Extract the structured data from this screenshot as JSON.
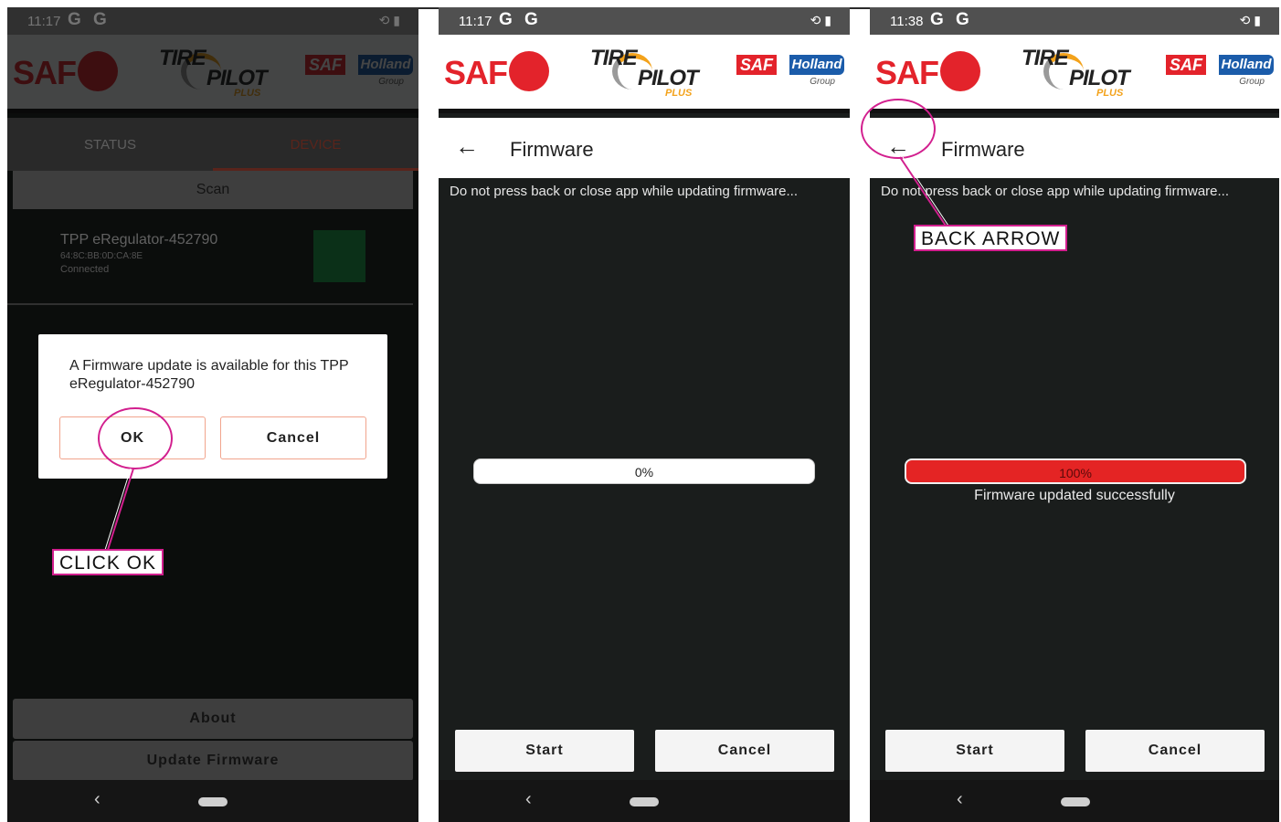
{
  "screens": [
    {
      "status": {
        "time": "11:17",
        "g_icons": "G G"
      },
      "logos": {
        "saf": "SAF",
        "tire1": "TIRE",
        "tire2": "PILOT",
        "tire3": "PLUS",
        "holland1": "SAF",
        "holland2": "Holland",
        "holland3": "Group"
      },
      "tabs": {
        "left": "STATUS",
        "right": "DEVICE"
      },
      "scan": "Scan",
      "device": {
        "name": "TPP eRegulator-452790",
        "mac": "64:8C:BB:0D:CA:8E",
        "state": "Connected",
        "color": "#1a6b35"
      },
      "dialog": {
        "message": "A Firmware update is available for this TPP eRegulator-452790",
        "ok": "OK",
        "cancel": "Cancel"
      },
      "buttons": {
        "about": "About",
        "update": "Update Firmware"
      }
    },
    {
      "status": {
        "time": "11:17",
        "g_icons": "G G"
      },
      "logos": {
        "saf": "SAF",
        "tire1": "TIRE",
        "tire2": "PILOT",
        "tire3": "PLUS",
        "holland1": "SAF",
        "holland2": "Holland",
        "holland3": "Group"
      },
      "title": "Firmware",
      "warning": "Do not press back or close app while updating firmware...",
      "progress": {
        "label": "0%",
        "value": 0
      },
      "buttons": {
        "start": "Start",
        "cancel": "Cancel"
      }
    },
    {
      "status": {
        "time": "11:38",
        "g_icons": "G G"
      },
      "logos": {
        "saf": "SAF",
        "tire1": "TIRE",
        "tire2": "PILOT",
        "tire3": "PLUS",
        "holland1": "SAF",
        "holland2": "Holland",
        "holland3": "Group"
      },
      "title": "Firmware",
      "warning": "Do not press back or close app while updating firmware...",
      "progress": {
        "label": "100%",
        "value": 100,
        "color": "#e42424"
      },
      "success": "Firmware updated successfully",
      "buttons": {
        "start": "Start",
        "cancel": "Cancel"
      }
    }
  ],
  "annotations": {
    "click_ok": "CLICK OK",
    "back_arrow": "BACK ARROW",
    "color": "#d21f8e"
  },
  "icons": {
    "back_arrow": "arrow-left-icon",
    "nav_back": "chevron-left-icon",
    "home": "home-pill-icon",
    "sync": "sync-icon",
    "battery": "battery-icon"
  }
}
